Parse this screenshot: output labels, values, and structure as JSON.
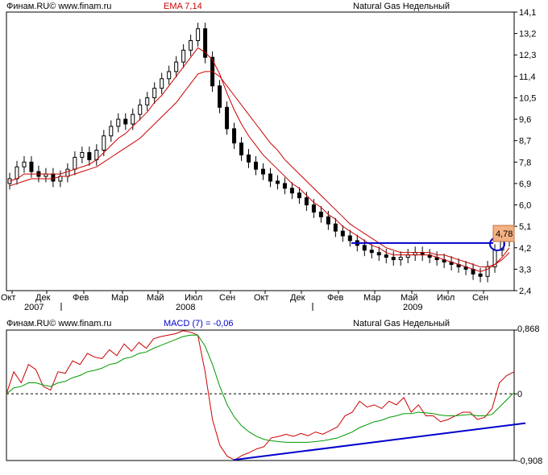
{
  "main_chart": {
    "header_left": "Финам.RU© www.finam.ru",
    "indicator_label": "EMA 7,14",
    "instrument": "Natural Gas Недельный",
    "price_label": "4,78",
    "price_level": 4.78,
    "colors": {
      "ema_fast": "#cc0000",
      "ema_slow": "#cc0000",
      "trendline": "#0000cc",
      "price_tag": "#f4b183"
    }
  },
  "macd_panel": {
    "header_left": "Финам.RU© www.finam.ru",
    "indicator_label": "MACD (7) = -0,06",
    "instrument": "Natural Gas Недельный",
    "colors": {
      "macd": "#cc0000",
      "signal": "#009900",
      "trendline": "#0000cc"
    }
  },
  "chart_data": [
    {
      "type": "candlestick",
      "title": "Natural Gas Недельный",
      "y_ticks": [
        "14,1",
        "13,2",
        "12,3",
        "11,4",
        "10,5",
        "9,6",
        "8,7",
        "7,8",
        "6,9",
        "6,0",
        "5,1",
        "4,2",
        "3,3",
        "2,4"
      ],
      "ylim": [
        2.4,
        14.1
      ],
      "x_ticks": [
        "Окт",
        "Дек",
        "Фев",
        "Мар",
        "Май",
        "Июл",
        "Сен",
        "Окт",
        "Дек",
        "Фев",
        "Мар",
        "Май",
        "Июл",
        "Сен"
      ],
      "x_years": [
        "2007",
        "2008",
        "2009"
      ],
      "close": [
        7.1,
        7.6,
        7.8,
        7.4,
        7.2,
        7.3,
        7.0,
        7.2,
        7.5,
        8.0,
        8.2,
        7.9,
        8.3,
        8.9,
        9.3,
        9.6,
        9.4,
        9.8,
        10.2,
        10.5,
        10.9,
        11.3,
        11.6,
        12.0,
        12.5,
        12.9,
        13.4,
        12.2,
        11.0,
        10.1,
        9.2,
        8.6,
        8.1,
        7.8,
        7.5,
        7.3,
        7.0,
        6.9,
        6.7,
        6.5,
        6.3,
        6.0,
        5.7,
        5.5,
        5.2,
        4.9,
        4.7,
        4.5,
        4.3,
        4.1,
        4.0,
        3.9,
        3.8,
        3.7,
        3.8,
        3.9,
        4.0,
        3.9,
        3.8,
        3.7,
        3.6,
        3.5,
        3.4,
        3.3,
        3.1,
        3.0,
        3.4,
        4.1,
        4.5,
        4.8
      ],
      "ema_fast": [
        7.0,
        7.1,
        7.3,
        7.3,
        7.3,
        7.3,
        7.3,
        7.3,
        7.4,
        7.5,
        7.6,
        7.7,
        7.9,
        8.2,
        8.5,
        8.8,
        9.0,
        9.3,
        9.6,
        9.9,
        10.3,
        10.6,
        11.0,
        11.4,
        11.8,
        12.2,
        12.6,
        12.4,
        12.1,
        11.5,
        10.7,
        10.0,
        9.4,
        8.9,
        8.5,
        8.1,
        7.8,
        7.5,
        7.2,
        6.9,
        6.7,
        6.4,
        6.1,
        5.9,
        5.6,
        5.4,
        5.1,
        4.9,
        4.7,
        4.5,
        4.3,
        4.2,
        4.0,
        3.9,
        3.9,
        3.9,
        3.9,
        3.9,
        3.9,
        3.8,
        3.7,
        3.6,
        3.5,
        3.4,
        3.3,
        3.2,
        3.3,
        3.5,
        3.8,
        4.2
      ],
      "ema_slow": [
        6.8,
        6.9,
        7.0,
        7.1,
        7.1,
        7.1,
        7.1,
        7.2,
        7.2,
        7.3,
        7.4,
        7.5,
        7.6,
        7.8,
        8.0,
        8.2,
        8.4,
        8.6,
        8.8,
        9.1,
        9.4,
        9.7,
        10.0,
        10.3,
        10.7,
        11.1,
        11.5,
        11.6,
        11.6,
        11.4,
        11.0,
        10.6,
        10.2,
        9.8,
        9.4,
        9.0,
        8.6,
        8.3,
        7.9,
        7.6,
        7.3,
        7.0,
        6.7,
        6.4,
        6.1,
        5.8,
        5.5,
        5.2,
        5.0,
        4.8,
        4.6,
        4.4,
        4.2,
        4.1,
        4.0,
        4.0,
        4.0,
        4.0,
        4.0,
        3.9,
        3.9,
        3.8,
        3.7,
        3.6,
        3.5,
        3.4,
        3.4,
        3.5,
        3.7,
        4.0
      ],
      "trendline_horizontal": 4.4,
      "current_price": 4.78
    },
    {
      "type": "line",
      "title": "MACD (7) = -0,06",
      "y_ticks": [
        "0,868",
        "0",
        "-0,908"
      ],
      "ylim": [
        -0.908,
        0.868
      ],
      "zero_line": 0,
      "series": [
        {
          "name": "MACD (7)",
          "values": [
            0.0,
            0.3,
            0.15,
            0.4,
            0.33,
            0.1,
            0.05,
            0.3,
            0.28,
            0.45,
            0.4,
            0.55,
            0.5,
            0.48,
            0.6,
            0.52,
            0.68,
            0.58,
            0.7,
            0.62,
            0.75,
            0.78,
            0.8,
            0.82,
            0.86,
            0.84,
            0.8,
            0.3,
            -0.35,
            -0.7,
            -0.85,
            -0.9,
            -0.84,
            -0.8,
            -0.75,
            -0.72,
            -0.6,
            -0.58,
            -0.55,
            -0.58,
            -0.54,
            -0.57,
            -0.52,
            -0.55,
            -0.5,
            -0.45,
            -0.3,
            -0.25,
            -0.1,
            -0.18,
            -0.15,
            -0.2,
            -0.1,
            -0.15,
            -0.05,
            -0.25,
            -0.15,
            -0.3,
            -0.3,
            -0.38,
            -0.35,
            -0.3,
            -0.25,
            -0.25,
            -0.35,
            -0.32,
            -0.2,
            0.15,
            0.25,
            0.3
          ]
        },
        {
          "name": "Signal",
          "values": [
            0.0,
            0.08,
            0.1,
            0.15,
            0.15,
            0.12,
            0.1,
            0.15,
            0.17,
            0.22,
            0.25,
            0.3,
            0.32,
            0.35,
            0.4,
            0.42,
            0.48,
            0.5,
            0.55,
            0.57,
            0.62,
            0.66,
            0.7,
            0.74,
            0.78,
            0.8,
            0.8,
            0.65,
            0.4,
            0.1,
            -0.15,
            -0.32,
            -0.44,
            -0.52,
            -0.58,
            -0.62,
            -0.64,
            -0.65,
            -0.66,
            -0.66,
            -0.66,
            -0.66,
            -0.65,
            -0.64,
            -0.62,
            -0.6,
            -0.56,
            -0.52,
            -0.46,
            -0.42,
            -0.38,
            -0.36,
            -0.32,
            -0.3,
            -0.27,
            -0.27,
            -0.25,
            -0.26,
            -0.27,
            -0.29,
            -0.3,
            -0.3,
            -0.29,
            -0.28,
            -0.3,
            -0.3,
            -0.28,
            -0.18,
            -0.08,
            0.02
          ]
        }
      ],
      "trendline": {
        "from": -0.9,
        "to": -0.4
      }
    }
  ]
}
